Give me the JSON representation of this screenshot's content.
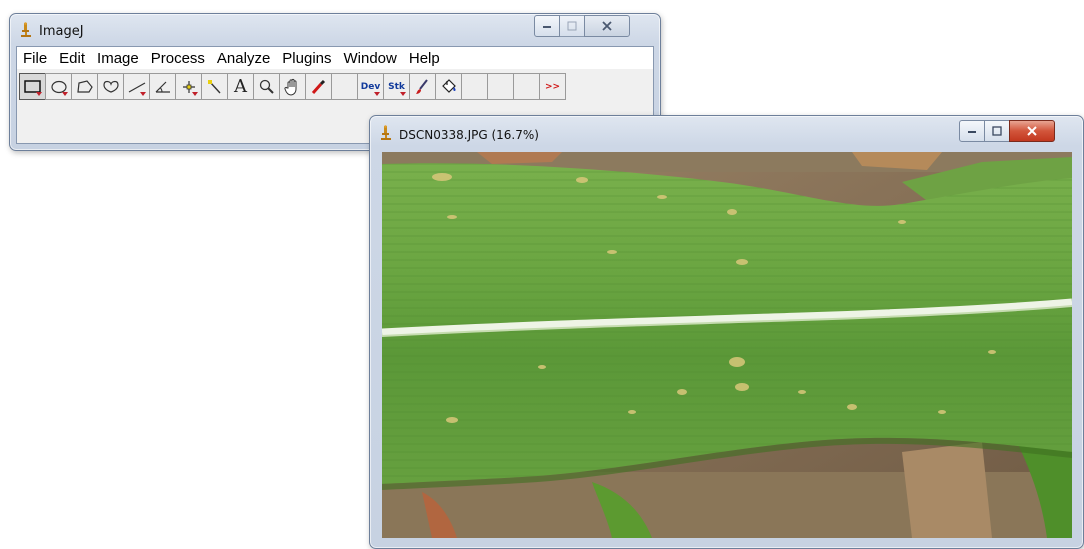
{
  "main_window": {
    "title": "ImageJ",
    "menus": [
      "File",
      "Edit",
      "Image",
      "Process",
      "Analyze",
      "Plugins",
      "Window",
      "Help"
    ],
    "toolbar": {
      "letter_tool": "A",
      "dev_label": "Dev",
      "stk_label": "Stk",
      "more_label": ">>"
    }
  },
  "image_window": {
    "title": "DSCN0338.JPG (16.7%)"
  },
  "colors": {
    "leaf_green": "#5f9a3c",
    "leaf_light": "#8cbf5a",
    "soil": "#8a7357",
    "midrib": "#e8f0e0",
    "close_red": "#c2381f"
  }
}
